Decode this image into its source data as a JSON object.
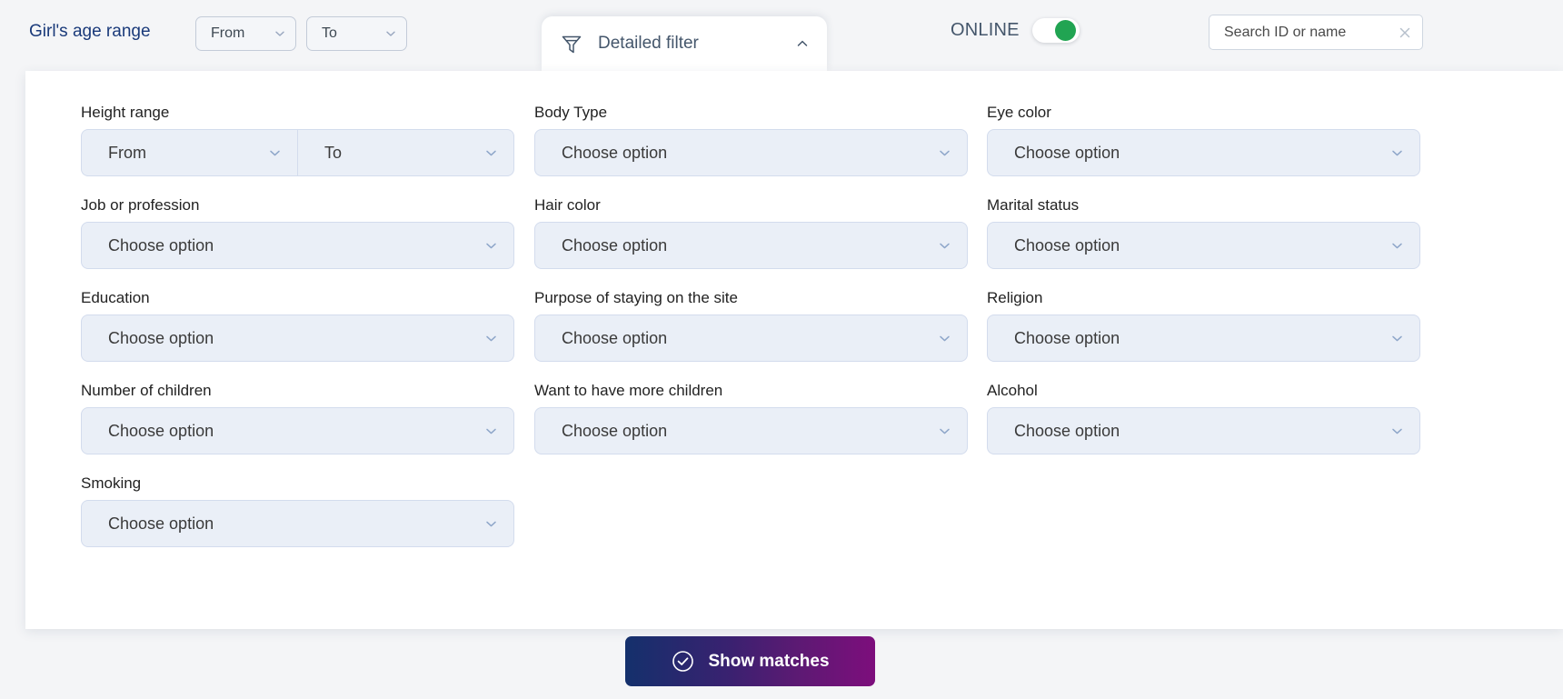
{
  "topbar": {
    "age_range_label": "Girl's age range",
    "age_from": "From",
    "age_to": "To",
    "online_label": "ONLINE",
    "online_enabled": true,
    "search_value": "",
    "search_placeholder": "Search ID or name",
    "icons": {
      "chevron_down": "chevron-down-icon",
      "clear": "close-icon"
    }
  },
  "filter_tab": {
    "label": "Detailed filter",
    "expanded": true,
    "funnel_icon": "funnel-icon",
    "toggle_icon": "chevron-up-icon"
  },
  "placeholders": {
    "choose_option": "Choose option",
    "from": "From",
    "to": "To"
  },
  "fields": [
    {
      "label": "Height range",
      "type": "range",
      "from": "From",
      "to": "To",
      "col": 1,
      "row": 1
    },
    {
      "label": "Body Type",
      "type": "select",
      "value": "Choose option",
      "col": 2,
      "row": 1
    },
    {
      "label": "Eye color",
      "type": "select",
      "value": "Choose option",
      "col": 3,
      "row": 1
    },
    {
      "label": "Job or profession",
      "type": "select",
      "value": "Choose option",
      "col": 1,
      "row": 2
    },
    {
      "label": "Hair color",
      "type": "select",
      "value": "Choose option",
      "col": 2,
      "row": 2
    },
    {
      "label": "Marital status",
      "type": "select",
      "value": "Choose option",
      "col": 3,
      "row": 2
    },
    {
      "label": "Education",
      "type": "select",
      "value": "Choose option",
      "col": 1,
      "row": 3
    },
    {
      "label": "Purpose of staying on the site",
      "type": "select",
      "value": "Choose option",
      "col": 2,
      "row": 3
    },
    {
      "label": "Religion",
      "type": "select",
      "value": "Choose option",
      "col": 3,
      "row": 3
    },
    {
      "label": "Number of children",
      "type": "select",
      "value": "Choose option",
      "col": 1,
      "row": 4
    },
    {
      "label": "Want to have more children",
      "type": "select",
      "value": "Choose option",
      "col": 2,
      "row": 4
    },
    {
      "label": "Alcohol",
      "type": "select",
      "value": "Choose option",
      "col": 3,
      "row": 4
    },
    {
      "label": "Smoking",
      "type": "select",
      "value": "Choose option",
      "col": 1,
      "row": 5
    }
  ],
  "submit": {
    "label": "Show matches",
    "icon": "check-circle-icon"
  },
  "colors": {
    "accent_blue": "#1a3a7a",
    "toggle_on_green": "#21a452",
    "button_gradient_start": "#14306c",
    "button_gradient_end": "#7d0e7c",
    "field_bg": "#eaeff7",
    "page_bg": "#f4f5f7"
  }
}
